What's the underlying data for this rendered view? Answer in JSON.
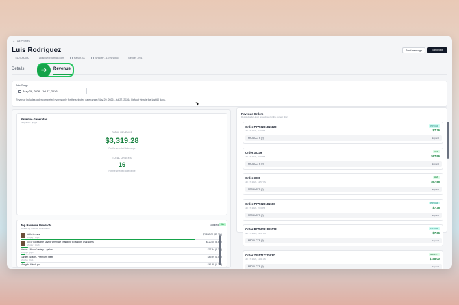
{
  "nav": {
    "back_label": "All Profiles"
  },
  "profile": {
    "name": "Luis Rodriguez",
    "phone": "5107050550",
    "email": "zlosigue@hotmail.com",
    "location": "Harlan, IA",
    "birthday": "Birthday - 12/26/1985",
    "gender": "Gender - N/A"
  },
  "actions": {
    "send_message": "Send message",
    "edit_profile": "Edit profile"
  },
  "tabs": [
    {
      "label": "Details"
    },
    {
      "label": "Revenue"
    }
  ],
  "date_range": {
    "label": "Date Range",
    "value": "May 29, 2026 - Jul 27, 2026",
    "note": "Revenue includes order completed events only for the selected date range (May 29, 2026 - Jul 27, 2026). Default view is the last 60 days."
  },
  "revenue_generated": {
    "title": "Revenue Generated",
    "subtitle": "Integration: grogel",
    "total_revenue_label": "TOTAL REVENUE",
    "total_revenue_value": "$3,319.28",
    "total_revenue_sub": "For the selected date range",
    "total_orders_label": "TOTAL ORDERS",
    "total_orders_value": "16",
    "total_orders_sub": "For the selected date range"
  },
  "top_products": {
    "title": "Top Revenue Products",
    "subtitle": "Ranked by revenue contribution",
    "toggle_a": "Grouped",
    "toggle_b": "Sku",
    "items": [
      {
        "name": "Hello to ease",
        "meta": "Shopify • Qty 1",
        "amount": "$2,899.00 (87.3%)",
        "share": 0.873,
        "thumb": true
      },
      {
        "name": "Kill or Lovesome saying when we changing to random characters",
        "meta": "Shopify • Qty 6",
        "amount": "$120.00 (3.6%)",
        "share": 0.036,
        "thumb": true
      },
      {
        "name": "Hostas - Mixed Variety 1 gallon",
        "meta": "Shopify • Qty 3",
        "amount": "$77.94 (2.3%)",
        "share": 0.023,
        "thumb": false
      },
      {
        "name": "Garden Spade - Premium Steel",
        "meta": "Shopify • Qty 1",
        "amount": "$49.99 (1.5%)",
        "share": 0.015,
        "thumb": false
      },
      {
        "name": "Marigold 6 inch pot",
        "meta": "Shopify • Qty 3",
        "amount": "$41.98 (1.3%)",
        "share": 0.013,
        "thumb": false
      },
      {
        "name": "NICE S",
        "meta": "Launch • Qty 4",
        "amount": "$39.36 (1.2%)",
        "share": 0.012,
        "thumb": false
      }
    ]
  },
  "orders": {
    "title": "Revenue Orders",
    "subtitle": "Detailed order-level breakdown for the current filters",
    "products_label": "PRODUCTS (2)",
    "expand_label": "Expand",
    "items": [
      {
        "id": "Order P7756291815120",
        "date": "Jul 17, 2026, 2:30 PM",
        "badge": "POSCAR",
        "amount": "$7.36"
      },
      {
        "id": "Order 30239",
        "date": "Jul 17, 2026, 3:00 PM",
        "badge": "WEB",
        "amount": "$67.96"
      },
      {
        "id": "Order 3080",
        "date": "Jul 17, 2026, 12:57 PM",
        "badge": "WEB",
        "amount": "$67.86"
      },
      {
        "id": "Order P77562918150C",
        "date": "Jul 17, 2026, 2:03 PM",
        "badge": "POSCAR",
        "amount": "$7.36"
      },
      {
        "id": "Order P7756291815128",
        "date": "Jul 17, 2026, 11:52 AM",
        "badge": "POSCAR",
        "amount": "$7.36"
      },
      {
        "id": "Order 7051717775037",
        "date": "Jul 17, 2026, 11:08 AM",
        "badge": "SHOPIFY",
        "amount": "$158.00"
      }
    ]
  },
  "colors": {
    "accent": "#16a34a",
    "money": "#15803d",
    "dark_button": "#111827"
  }
}
